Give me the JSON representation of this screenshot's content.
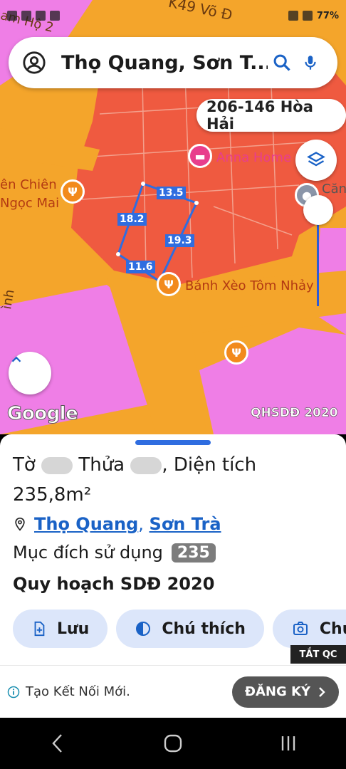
{
  "status_bar": {
    "time": "77%"
  },
  "search": {
    "query": "Thọ Quang, Sơn T..."
  },
  "address_chip": "206-146 Hòa Hải",
  "map": {
    "labels": {
      "anna_home": "Anna Home",
      "chien": "ên Chiên",
      "ngoc_mai": "Ngọc Mai",
      "banh_xeo": "Bánh Xèo Tôm Nhảy",
      "cang": "Căn",
      "road": "K49 Võ Đ",
      "road2": "am Hộ 2",
      "side": "ình"
    },
    "measurements": [
      "13.5",
      "18.2",
      "19.3",
      "11.6"
    ],
    "google": "Google",
    "qhsdd": "QHSDĐ 2020"
  },
  "parcel": {
    "to_label": "Tờ",
    "thua_label": "Thửa",
    "area_label": ", Diện tích",
    "area_value": "235,8m²",
    "location": {
      "ward": "Thọ Quang",
      "separator": ",",
      "district": "Sơn Trà"
    },
    "purpose_label": "Mục đích sử dụng",
    "purpose_code": "235",
    "plan": "Quy hoạch SDĐ 2020"
  },
  "actions": [
    {
      "label": "Lưu",
      "icon": "add-file-icon"
    },
    {
      "label": "Chú thích",
      "icon": "legend-icon"
    },
    {
      "label": "Chụp",
      "icon": "camera-icon"
    }
  ],
  "ad": {
    "close_label": "TẮT QC",
    "text": "Tạo Kết Nối Mới.",
    "cta": "ĐĂNG KÝ"
  },
  "colors": {
    "orange": "#f4a52b",
    "red": "#ef5a40",
    "pink": "#ef7ee6",
    "accent": "#2f6de0"
  }
}
